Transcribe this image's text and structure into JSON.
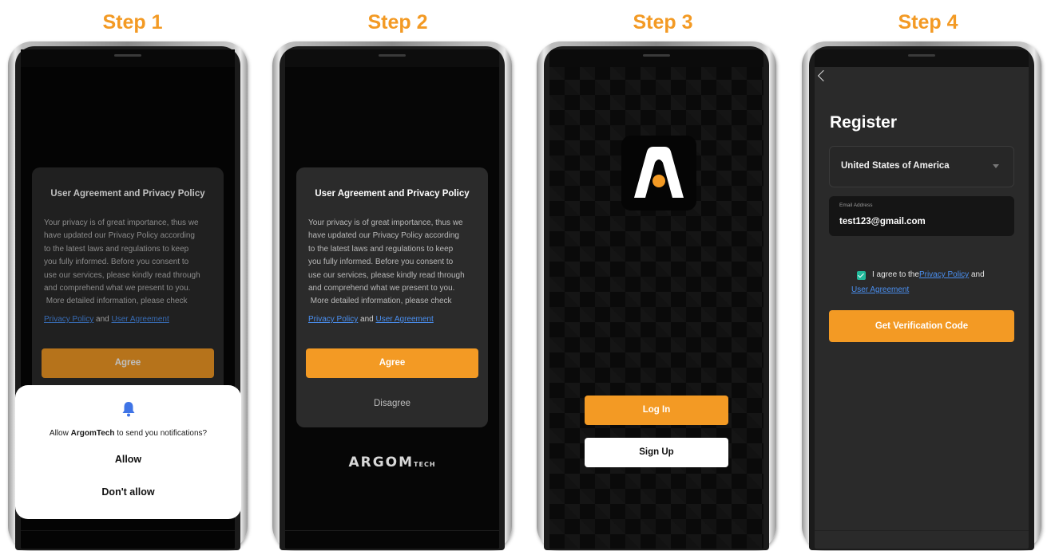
{
  "steps": [
    "Step 1",
    "Step 2",
    "Step 3",
    "Step 4"
  ],
  "colors": {
    "accent": "#f39a24",
    "link": "#4a8ff0",
    "checkbox": "#21b89a"
  },
  "agreement_dialog": {
    "title": "User Agreement and Privacy Policy",
    "body_lines": [
      "Your privacy is of great importance, thus we",
      "have updated our Privacy Policy according",
      "to the latest laws and regulations to keep",
      "you fully informed. Before you consent to",
      "use our services, please kindly read through",
      "and comprehend what we present to you.",
      " More detailed information, please check"
    ],
    "privacy_link": "Privacy Policy",
    "and": "and",
    "user_agreement_link": "User Agreement",
    "agree_label": "Agree",
    "disagree_label": "Disagree"
  },
  "notification": {
    "icon": "bell-icon",
    "prefix": "Allow ",
    "app_name": "ArgomTech",
    "suffix": " to send you notifications?",
    "allow_label": "Allow",
    "deny_label": "Don't allow"
  },
  "brand": {
    "main": "ARGOM",
    "sub": "TECH"
  },
  "welcome": {
    "login_label": "Log In",
    "signup_label": "Sign Up",
    "logo_icon": "argomtech-logo-icon"
  },
  "register": {
    "title": "Register",
    "country": "United States of America",
    "email_label": "Email Address",
    "email_value": "test123@gmail.com",
    "agree_prefix": "I agree to the",
    "privacy_link": "Privacy Policy",
    "and": " and",
    "user_agreement_link": "User Agreement",
    "verify_label": "Get Verification Code"
  }
}
